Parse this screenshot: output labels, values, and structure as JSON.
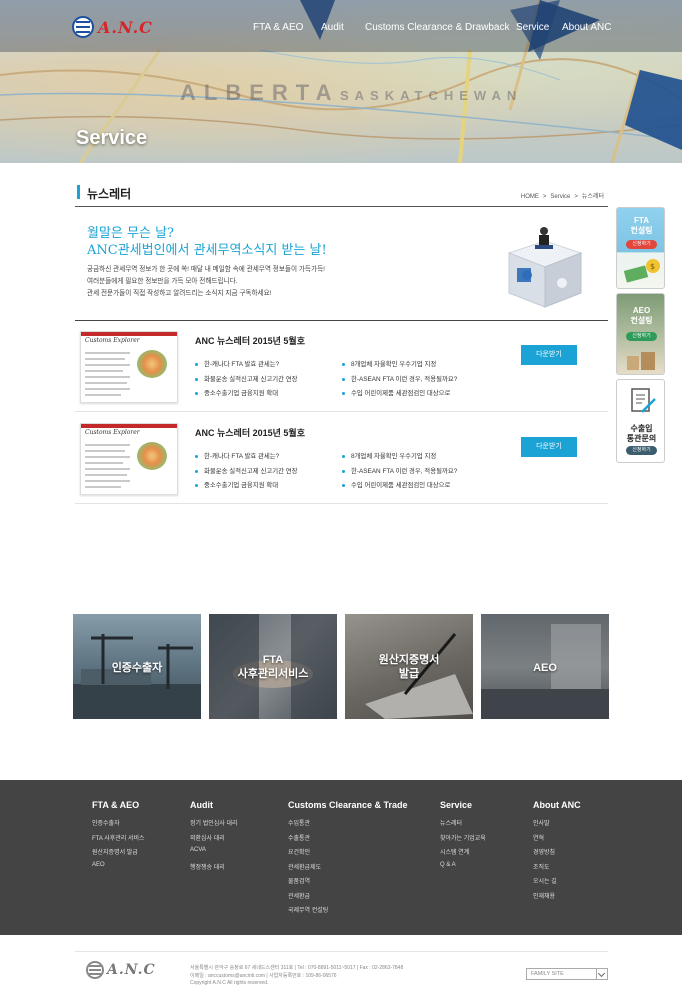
{
  "header": {
    "logo_text": "A.N.C",
    "nav": [
      "FTA & AEO",
      "Audit",
      "Customs Clearance & Drawback",
      "Service",
      "About ANC"
    ],
    "hero_title": "Service"
  },
  "page": {
    "title": "뉴스레터",
    "breadcrumb": [
      "HOME",
      "Service",
      "뉴스레터"
    ]
  },
  "intro": {
    "heading1": "월말은 무슨 날?",
    "heading2": "ANC관세법인에서 관세무역소식지 받는 날!",
    "lines": [
      "궁금하신 관세무역 정보가 한 곳에 쏙! 매달 내 메일함 속에 관세무역 정보들이 가득가득!",
      "여러분들에게 필요한 정보만을 가득 모아 전해드립니다.",
      "관세 전문가들이 직접 작성하고 알려드리는 소식지 지금 구독하세요!"
    ]
  },
  "newsletters": [
    {
      "thumb_title": "Customs Explorer",
      "title": "ANC 뉴스레터 2015년 5월호",
      "left_items": [
        "한-캐나다 FTA 발효 관세는?",
        "화물운송 실적신고제 신고기간 연장",
        "중소수출기업 금융지원 확대"
      ],
      "right_items": [
        "8개업체 자율확인 우수기업 지정",
        "한-ASEAN FTA 이런 경우, 적용될까요?",
        "수입 어린이제품 세관점검인 대상으로"
      ],
      "button": "다운받기"
    },
    {
      "thumb_title": "Customs Explorer",
      "title": "ANC 뉴스레터 2015년 5월호",
      "left_items": [
        "한-캐나다 FTA 발효 관세는?",
        "화물운송 실적신고제 신고기간 연장",
        "중소수출기업 금융지원 확대"
      ],
      "right_items": [
        "8개업체 자율확인 우수기업 지정",
        "한-ASEAN FTA 이런 경우, 적용될까요?",
        "수입 어린이제품 세관점검인 대상으로"
      ],
      "button": "다운받기"
    }
  ],
  "side_menu": [
    {
      "label1": "FTA",
      "label2": "컨설팅",
      "pill": "신청하기"
    },
    {
      "label1": "AEO",
      "label2": "컨설팅",
      "pill": "신청하기"
    },
    {
      "label1": "수출입",
      "label2": "통관문의",
      "pill": "신청하기"
    }
  ],
  "tiles": [
    {
      "line1": "인증수출자",
      "line2": ""
    },
    {
      "line1": "FTA",
      "line2": "사후관리서비스"
    },
    {
      "line1": "원산지증명서",
      "line2": "발급"
    },
    {
      "line1": "AEO",
      "line2": ""
    }
  ],
  "footer": {
    "columns": [
      {
        "heading": "FTA & AEO",
        "items": [
          "인증수출자",
          "FTA 사후관리 서비스",
          "원산지증명서 발급",
          "AEO"
        ]
      },
      {
        "heading": "Audit",
        "items": [
          "정기 법인심사 대리",
          "외환심사 대리",
          "ACVA",
          "행정쟁송 대리"
        ]
      },
      {
        "heading": "Customs Clearance & Trade",
        "items": [
          "수입통관",
          "수출통관",
          "요건확인",
          "관세환급제도",
          "물품검역",
          "관세환급",
          "국제무역 컨설팅"
        ]
      },
      {
        "heading": "Service",
        "items": [
          "뉴스레터",
          "찾아가는 기업교육",
          "시스템 연계",
          "Q & A"
        ]
      },
      {
        "heading": "About ANC",
        "items": [
          "인사말",
          "연혁",
          "경영방침",
          "조직도",
          "오시는 길",
          "인재채용"
        ]
      }
    ],
    "address_line1": "서울특별시 관악구 승정로 67 세네드스센터 311호  |  Tel : 070-8891-5011~5017  |  Fax : 02-2863-7848",
    "address_line2": "이메일 : anccustoms@ancinti.com  |  사업자등록번호 : 109-86-06576",
    "copyright": "Copyright A.N.C All rights reserved.",
    "family_site": "FAMILY SITE"
  },
  "colors": {
    "accent": "#1aa3d4",
    "footer_bg": "#444444",
    "logo_red": "#d6262b"
  }
}
